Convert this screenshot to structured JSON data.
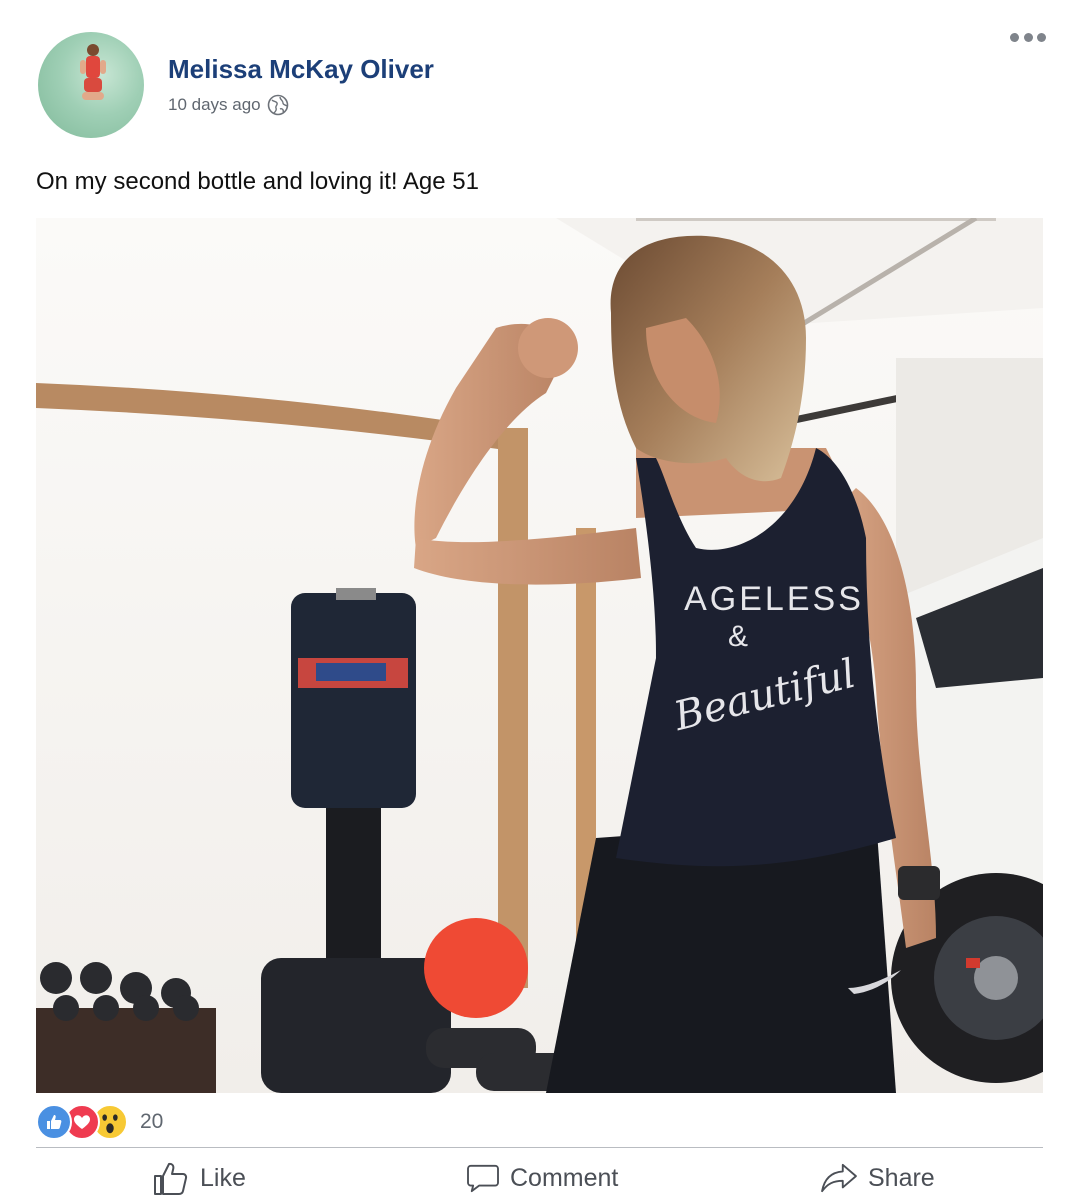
{
  "post": {
    "author": "Melissa McKay Oliver",
    "timestamp": "10 days ago",
    "privacy_icon": "globe-icon",
    "text": "On my second bottle and loving it! Age 51",
    "photo": {
      "shirt_line1": "AGELESS",
      "shirt_line2": "&",
      "shirt_line3": "Beautiful"
    }
  },
  "reactions": {
    "types": [
      "like-icon",
      "love-icon",
      "wow-icon"
    ],
    "count": "20"
  },
  "actions": {
    "like": "Like",
    "comment": "Comment",
    "share": "Share"
  },
  "colors": {
    "author_name": "#1c3f78",
    "meta": "#606770",
    "like_blue": "#4a90e2",
    "love_red": "#ef3b50",
    "wow_yellow": "#f7c934"
  }
}
